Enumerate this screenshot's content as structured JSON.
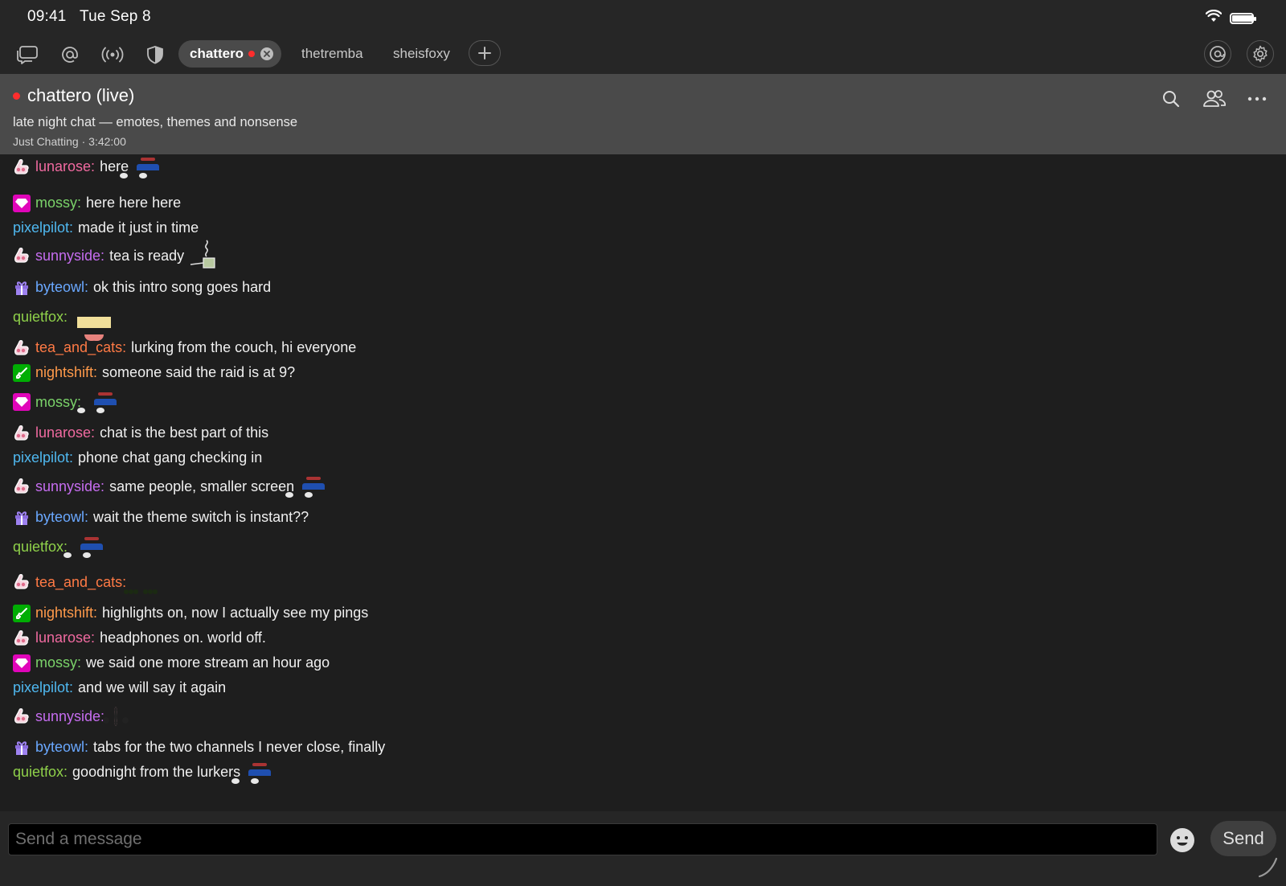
{
  "status_bar": {
    "time": "09:41",
    "date": "Tue Sep 8"
  },
  "tabbar": {
    "left_icons": [
      "chats-icon",
      "mentions-icon",
      "live-feed-icon",
      "moderation-shield-icon"
    ],
    "tabs": [
      {
        "label": "chattero",
        "active": true,
        "live": true
      },
      {
        "label": "thetremba",
        "active": false,
        "live": false
      },
      {
        "label": "sheisfoxy",
        "active": false,
        "live": false
      }
    ],
    "right_icons": [
      "account-icon",
      "settings-gear-icon"
    ]
  },
  "channel": {
    "title": "chattero (live)",
    "subtitle": "late night chat — emotes, themes and nonsense",
    "meta": "Just Chatting · 3:42:00"
  },
  "colors": {
    "lunarose": "#f06aa0",
    "mossy": "#7bd36a",
    "pixelpilot": "#4fb8f0",
    "sunnyside": "#c66df0",
    "byteowl": "#6aa8ff",
    "quietfox": "#8fd14a",
    "tea_and_cats": "#ff7a45",
    "nightshift": "#ff9a4a"
  },
  "messages": [
    {
      "user": "lunarose:",
      "badge": "sub",
      "text": "here",
      "emote": "pepe"
    },
    {
      "user": "mossy:",
      "badge": "vip",
      "text": "here here here"
    },
    {
      "user": "pixelpilot:",
      "text": "made it just in time"
    },
    {
      "user": "sunnyside:",
      "badge": "sub",
      "text": "tea is ready",
      "emote": "cup"
    },
    {
      "user": "byteowl:",
      "badge": "gift",
      "text": "ok this intro song goes hard"
    },
    {
      "user": "quietfox:",
      "text": "",
      "emote": "anime",
      "emote_count": 2
    },
    {
      "user": "tea_and_cats:",
      "badge": "sub",
      "text": "lurking from the couch, hi everyone"
    },
    {
      "user": "nightshift:",
      "badge": "mod",
      "text": "someone said the raid is at 9?"
    },
    {
      "user": "mossy:",
      "badge": "vip",
      "text": "",
      "emote": "pepe"
    },
    {
      "user": "lunarose:",
      "badge": "sub",
      "text": "chat is the best part of this"
    },
    {
      "user": "pixelpilot:",
      "text": "phone chat gang checking in"
    },
    {
      "user": "sunnyside:",
      "badge": "sub",
      "text": "same people, smaller screen",
      "emote": "pepe"
    },
    {
      "user": "byteowl:",
      "badge": "gift",
      "text": "wait the theme switch is instant??"
    },
    {
      "user": "quietfox:",
      "text": "",
      "emote": "pepe"
    },
    {
      "user": "tea_and_cats:",
      "badge": "sub",
      "text": "",
      "emote": "alien",
      "emote_count": 3
    },
    {
      "user": "nightshift:",
      "badge": "mod",
      "text": "highlights on, now I actually see my pings"
    },
    {
      "user": "lunarose:",
      "badge": "sub",
      "text": "headphones on. world off."
    },
    {
      "user": "mossy:",
      "badge": "vip",
      "text": "we said one more stream an hour ago"
    },
    {
      "user": "pixelpilot:",
      "text": "and we will say it again"
    },
    {
      "user": "sunnyside:",
      "badge": "sub",
      "text": "",
      "emote": "pink"
    },
    {
      "user": "byteowl:",
      "badge": "gift",
      "text": "tabs for the two channels I never close, finally"
    },
    {
      "user": "quietfox:",
      "text": "goodnight from the lurkers",
      "emote": "pepe"
    }
  ],
  "composer": {
    "placeholder": "Send a message",
    "value": "",
    "send_label": "Send"
  }
}
